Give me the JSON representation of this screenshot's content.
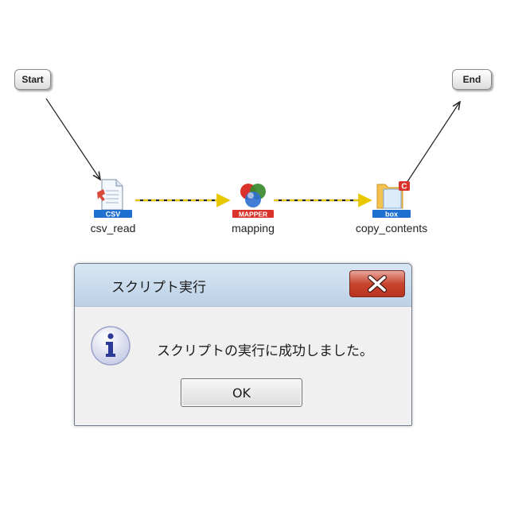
{
  "flow": {
    "start_label": "Start",
    "end_label": "End",
    "components": [
      {
        "name": "csv_read",
        "badge": "CSV",
        "badge_color": "#1e6fd0"
      },
      {
        "name": "mapping",
        "badge": "MAPPER",
        "badge_color": "#d9332b"
      },
      {
        "name": "copy_contents",
        "badge": "box",
        "badge_color": "#1e6fd0"
      }
    ],
    "flow_line_color": "#e8c800"
  },
  "dialog": {
    "title": "スクリプト実行",
    "message": "スクリプトの実行に成功しました。",
    "ok_label": "OK",
    "icon": "info-icon",
    "close_icon": "close-icon"
  }
}
